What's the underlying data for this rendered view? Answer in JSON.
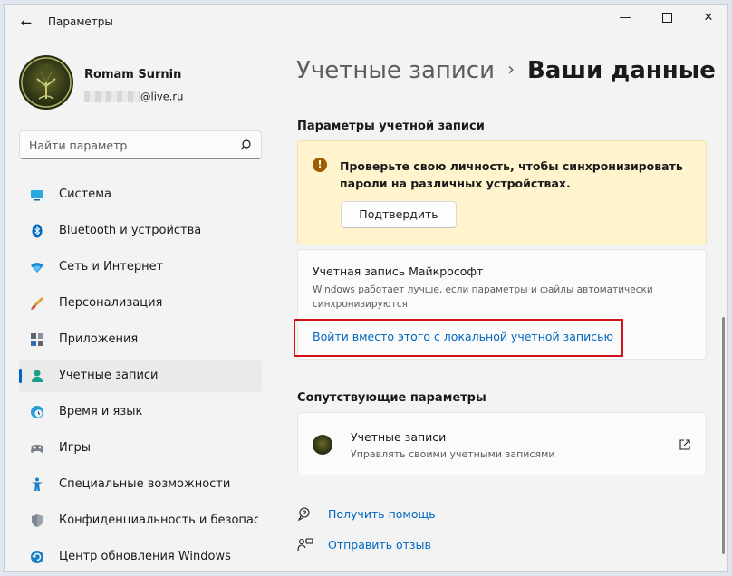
{
  "app": {
    "title": "Параметры"
  },
  "user": {
    "name": "Romam Surnin",
    "email_domain": "@live.ru"
  },
  "search": {
    "placeholder": "Найти параметр"
  },
  "nav": {
    "items": [
      {
        "id": "system",
        "label": "Система",
        "icon": "monitor-icon"
      },
      {
        "id": "bluetooth",
        "label": "Bluetooth и устройства",
        "icon": "bluetooth-icon"
      },
      {
        "id": "network",
        "label": "Сеть и Интернет",
        "icon": "wifi-icon"
      },
      {
        "id": "personalization",
        "label": "Персонализация",
        "icon": "brush-icon"
      },
      {
        "id": "apps",
        "label": "Приложения",
        "icon": "apps-icon"
      },
      {
        "id": "accounts",
        "label": "Учетные записи",
        "icon": "person-icon",
        "active": true
      },
      {
        "id": "time",
        "label": "Время и язык",
        "icon": "clock-globe-icon"
      },
      {
        "id": "gaming",
        "label": "Игры",
        "icon": "gamepad-icon"
      },
      {
        "id": "accessibility",
        "label": "Специальные возможности",
        "icon": "accessibility-icon"
      },
      {
        "id": "privacy",
        "label": "Конфиденциальность и безопасность",
        "icon": "shield-icon"
      },
      {
        "id": "update",
        "label": "Центр обновления Windows",
        "icon": "update-icon"
      }
    ]
  },
  "breadcrumb": {
    "parent": "Учетные записи",
    "separator": "›",
    "current": "Ваши данные"
  },
  "account_settings": {
    "title": "Параметры учетной записи",
    "warning": {
      "text": "Проверьте свою личность, чтобы синхронизировать пароли на различных устройствах.",
      "button": "Подтвердить"
    },
    "microsoft": {
      "title": "Учетная запись Майкрософт",
      "description": "Windows работает лучше, если параметры и файлы автоматически синхронизируются",
      "link": "Войти вместо этого с локальной учетной записью"
    }
  },
  "related": {
    "title": "Сопутствующие параметры",
    "item": {
      "title": "Учетные записи",
      "subtitle": "Управлять своими учетными записями"
    }
  },
  "help": {
    "get_help": "Получить помощь",
    "feedback": "Отправить отзыв"
  },
  "colors": {
    "accent": "#0067c0",
    "warning_bg": "#fff4ce",
    "highlight": "#d3121a"
  }
}
